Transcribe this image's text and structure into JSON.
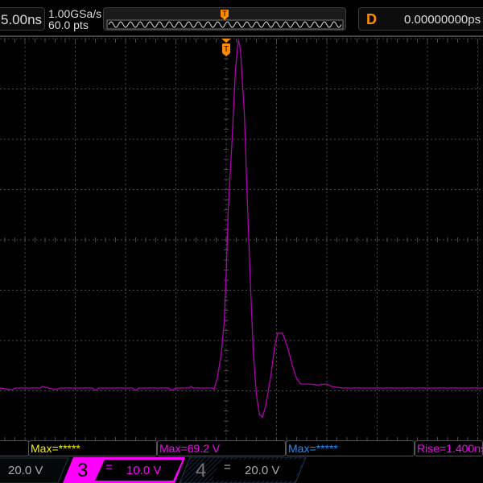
{
  "header": {
    "timebase": "5.00ns",
    "sample_rate": "1.00GSa/s",
    "memory_depth": "60.0 pts",
    "trigger_marker": "T",
    "delay_label": "D",
    "delay_value": "0.00000000ps"
  },
  "colors": {
    "ch1": "#f0f000",
    "ch3": "#ff00ff",
    "ch4": "#1e90ff",
    "trace": "#b000b0",
    "trigger": "#ff8c00",
    "grid": "#4a4a4a"
  },
  "measurements": [
    {
      "label": "",
      "color": "#cccccc"
    },
    {
      "label": "Max=*****",
      "color": "#f0f000"
    },
    {
      "label": "Max=69.2 V",
      "color": "#ff00ff"
    },
    {
      "label": "Max=*****",
      "color": "#1e90ff"
    },
    {
      "label": "Rise=1.400ns",
      "color": "#ff00ff"
    }
  ],
  "channels": {
    "ch2_scale": "20.0 V",
    "ch3_number": "3",
    "ch3_coupling": "=",
    "ch3_scale": "10.0 V",
    "ch4_number": "4",
    "ch4_coupling": "=",
    "ch4_scale": "20.0 V"
  },
  "waveform": {
    "channel": "3",
    "volts_per_div": 10.0,
    "ns_per_div": 5.0,
    "t_ns": [
      -22.5,
      -21.3,
      -20.9,
      -18.5,
      -18.3,
      -17.7,
      -16.9,
      -16.5,
      -13.3,
      -13.0,
      -12.7,
      -9.3,
      -9.0,
      -8.7,
      -5.7,
      -5.4,
      -5.0,
      -3.7,
      -3.5,
      -3.3,
      -1.5,
      -1.2,
      -0.9,
      -0.5,
      -0.2,
      0.0,
      0.2,
      0.6,
      0.9,
      1.2,
      1.4,
      1.8,
      2.1,
      2.4,
      2.7,
      3.0,
      3.3,
      3.6,
      3.9,
      4.4,
      4.8,
      5.1,
      5.6,
      6.1,
      6.6,
      7.0,
      7.4,
      8.3,
      9.1,
      9.9,
      10.5,
      11.5,
      25.5
    ],
    "v": [
      0,
      -0.3,
      0,
      0,
      0.3,
      0,
      -0.3,
      0,
      0,
      -0.5,
      0,
      0,
      -0.5,
      0,
      0,
      -0.5,
      0,
      0,
      0.3,
      0,
      0,
      -0.2,
      1.9,
      6.7,
      13.1,
      22.7,
      35.5,
      49.9,
      62.7,
      69.2,
      67.5,
      54.7,
      37.1,
      21.1,
      6.7,
      -1.3,
      -5.3,
      -5.8,
      -3.7,
      1.9,
      8.0,
      10.9,
      10.9,
      8.0,
      4.3,
      1.9,
      0.8,
      0.8,
      0.6,
      0.8,
      0.3,
      0,
      0
    ]
  }
}
